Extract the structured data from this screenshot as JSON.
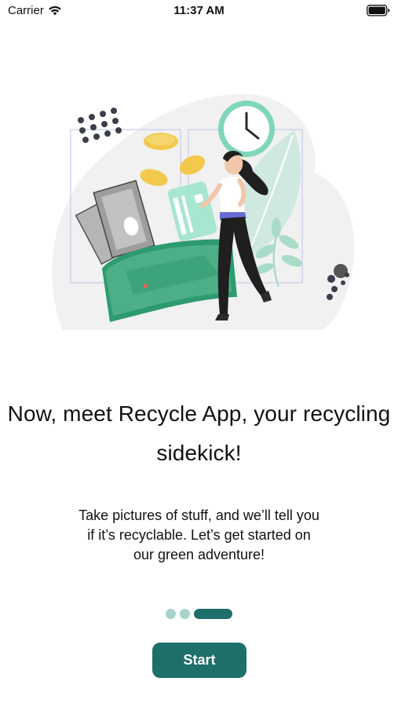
{
  "status_bar": {
    "carrier": "Carrier",
    "time": "11:37 AM"
  },
  "onboarding": {
    "headline_line1": "Now, meet Recycle App, your recycling",
    "headline_line2": "sidekick!",
    "body": "Take pictures of stuff, and we’ll tell you if it’s recyclable. Let’s get started on our green adventure!",
    "page_indicator": {
      "total": 3,
      "current": 3
    },
    "start_button_label": "Start"
  },
  "colors": {
    "accent": "#1e6e69",
    "indicator_inactive": "#a8d2cc",
    "wallet_green": "#4caf87",
    "card_mint": "#a7e6cf",
    "coin_gold": "#f2c94c"
  },
  "icons": {
    "wifi": "wifi-icon",
    "battery": "battery-icon"
  }
}
